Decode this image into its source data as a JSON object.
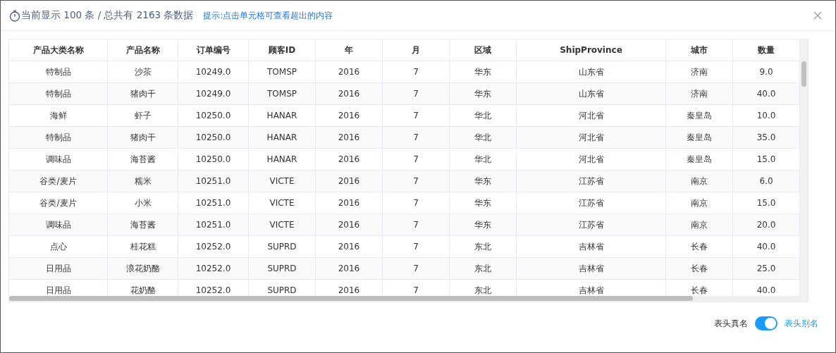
{
  "header": {
    "summary": "当前显示 100 条 / 总共有 2163 条数据",
    "hint": "提示:点击单元格可查看超出的内容"
  },
  "table": {
    "columns": [
      "产品大类名称",
      "产品名称",
      "订单编号",
      "顾客ID",
      "年",
      "月",
      "区域",
      "ShipProvince",
      "城市",
      "数量"
    ],
    "rows": [
      [
        "特制品",
        "沙茶",
        "10249.0",
        "TOMSP",
        "2016",
        "7",
        "华东",
        "山东省",
        "济南",
        "9.0"
      ],
      [
        "特制品",
        "猪肉干",
        "10249.0",
        "TOMSP",
        "2016",
        "7",
        "华东",
        "山东省",
        "济南",
        "40.0"
      ],
      [
        "海鲜",
        "虾子",
        "10250.0",
        "HANAR",
        "2016",
        "7",
        "华北",
        "河北省",
        "秦皇岛",
        "10.0"
      ],
      [
        "特制品",
        "猪肉干",
        "10250.0",
        "HANAR",
        "2016",
        "7",
        "华北",
        "河北省",
        "秦皇岛",
        "35.0"
      ],
      [
        "调味品",
        "海苔酱",
        "10250.0",
        "HANAR",
        "2016",
        "7",
        "华北",
        "河北省",
        "秦皇岛",
        "15.0"
      ],
      [
        "谷类/麦片",
        "糯米",
        "10251.0",
        "VICTE",
        "2016",
        "7",
        "华东",
        "江苏省",
        "南京",
        "6.0"
      ],
      [
        "谷类/麦片",
        "小米",
        "10251.0",
        "VICTE",
        "2016",
        "7",
        "华东",
        "江苏省",
        "南京",
        "15.0"
      ],
      [
        "调味品",
        "海苔酱",
        "10251.0",
        "VICTE",
        "2016",
        "7",
        "华东",
        "江苏省",
        "南京",
        "20.0"
      ],
      [
        "点心",
        "桂花糕",
        "10252.0",
        "SUPRD",
        "2016",
        "7",
        "东北",
        "吉林省",
        "长春",
        "40.0"
      ],
      [
        "日用品",
        "浪花奶酪",
        "10252.0",
        "SUPRD",
        "2016",
        "7",
        "东北",
        "吉林省",
        "长春",
        "25.0"
      ],
      [
        "日用品",
        "花奶酪",
        "10252.0",
        "SUPRD",
        "2016",
        "7",
        "东北",
        "吉林省",
        "长春",
        "40.0"
      ]
    ]
  },
  "footer": {
    "toggle": {
      "off_label": "表头真名",
      "on_label": "表头别名",
      "on": true
    }
  }
}
